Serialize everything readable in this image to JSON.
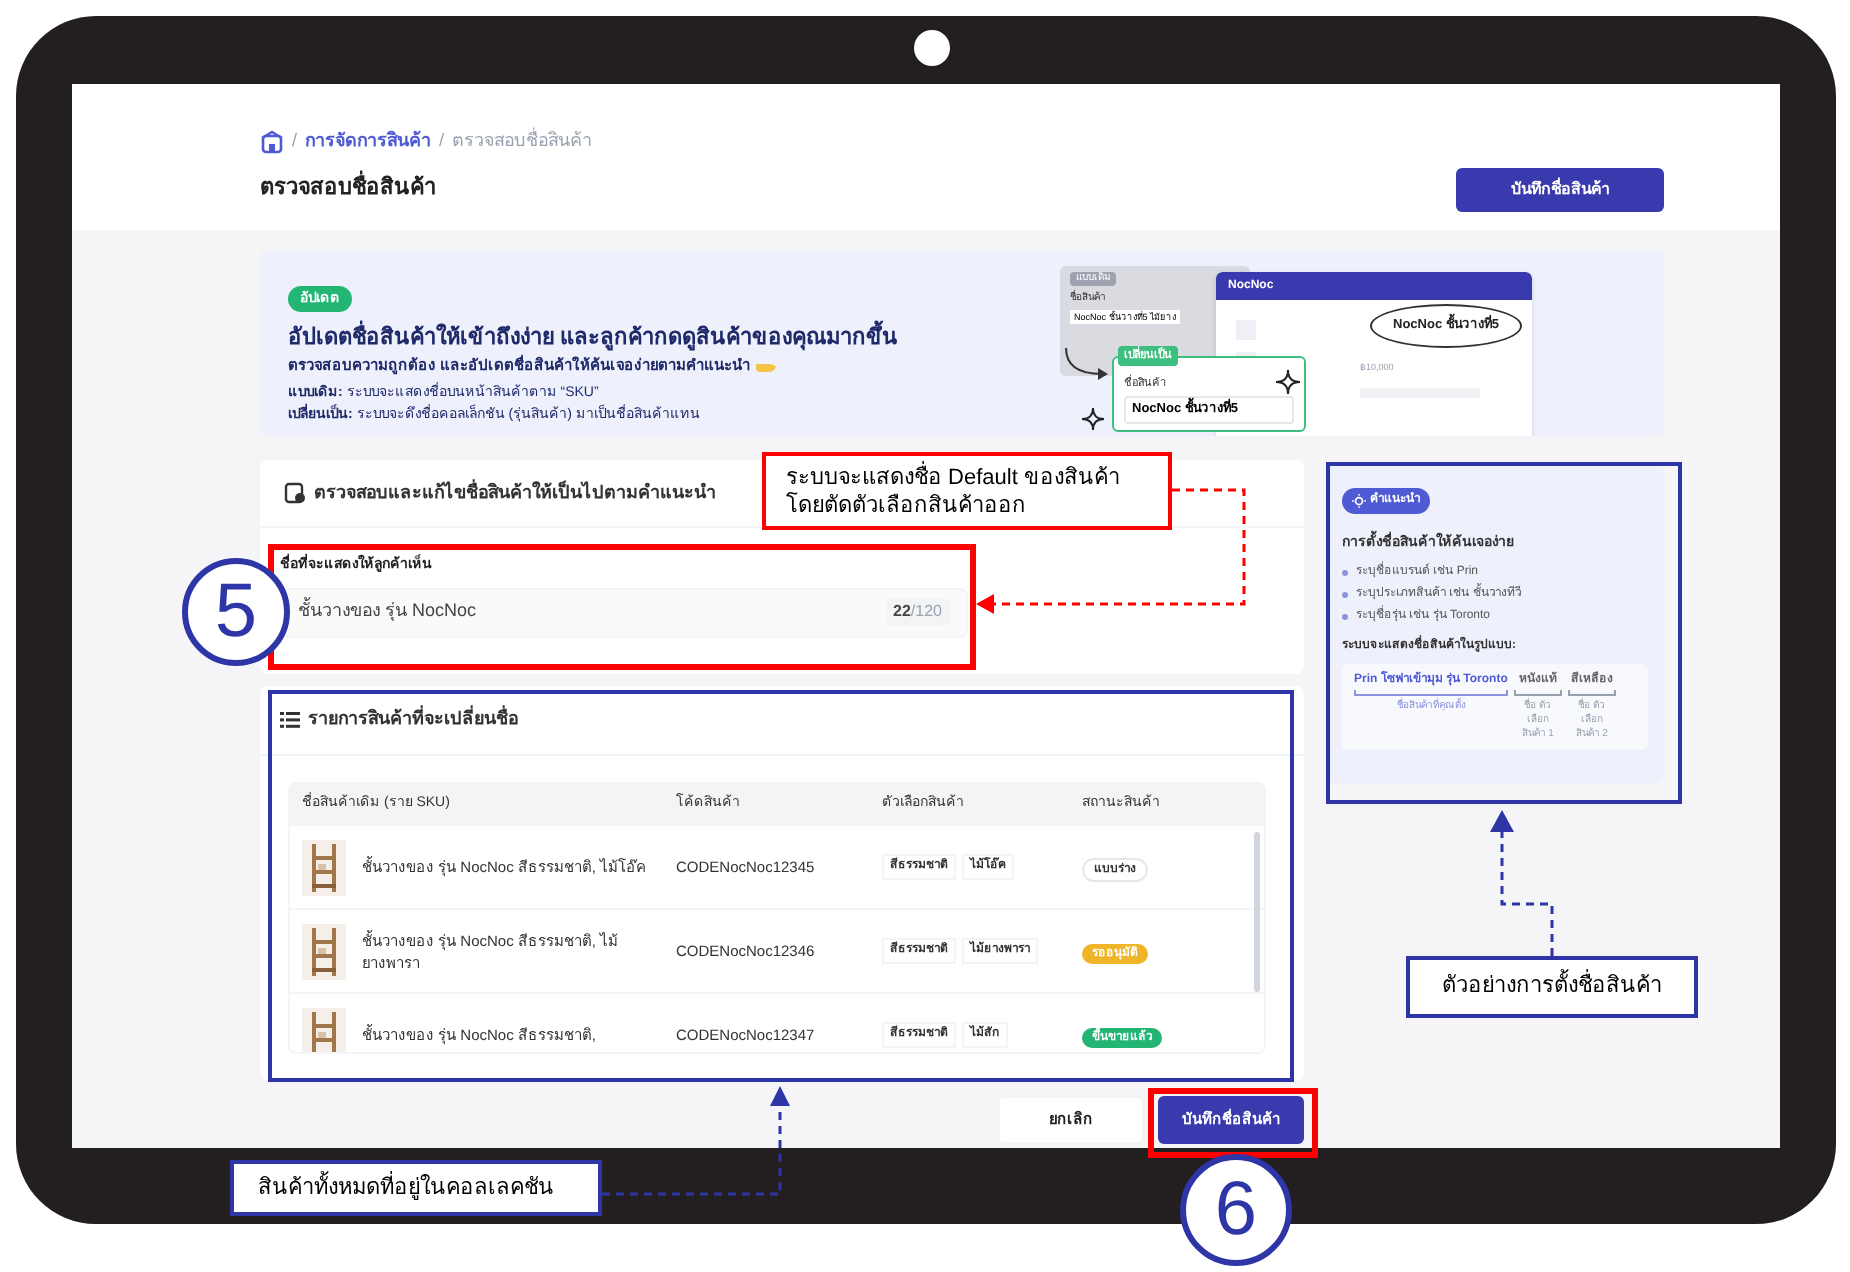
{
  "breadcrumb": {
    "separator": "/",
    "items": [
      {
        "label": "การจัดการสินค้า",
        "current": false
      },
      {
        "label": "ตรวจสอบชื่อสินค้า",
        "current": true
      }
    ]
  },
  "page_title": "ตรวจสอบชื่อสินค้า",
  "header_button": "บันทึกชื่อสินค้า",
  "banner": {
    "badge": "อัปเดต",
    "title": "อัปเดตชื่อสินค้าให้เข้าถึงง่าย และลูกค้ากดดูสินค้าของคุณมากขึ้น",
    "subtitle": "ตรวจสอบความถูกต้อง และอัปเดตชื่อสินค้าให้ค้นเจอง่ายตามคำแนะนำ",
    "lines": [
      "**แบบเดิม:** ระบบจะแสดงชื่อบนหน้าสินค้าตาม “SKU”",
      "**เปลี่ยนเป็น:** ระบบจะดึงชื่อคอลเล็กชัน (รุ่นสินค้า) มาเป็นชื่อสินค้าแทน"
    ],
    "illustration": {
      "old_badge": "แบบเดิม",
      "old_label": "ชื่อสินค้า",
      "old_value": "NocNoc ชั้นวางที่5 ไม้ยาง",
      "new_badge": "เปลี่ยนเป็น",
      "new_label": "ชื่อสินค้า",
      "new_value": "NocNoc ชั้นวางที่5",
      "preview_brand": "NocNoc",
      "preview_name": "NocNoc ชั้นวางที่5",
      "preview_price": "฿10,000"
    }
  },
  "name_section": {
    "title": "ตรวจสอบและแก้ไขชื่อสินค้าให้เป็นไปตามคำแนะนำ",
    "field_label": "ชื่อที่จะแสดงให้ลูกค้าเห็น",
    "field_value": "ชั้นวางของ รุ่น NocNoc",
    "count": "22",
    "max": "/120"
  },
  "list_section": {
    "title": "รายการสินค้าที่จะเปลี่ยนชื่อ",
    "columns": [
      "ชื่อสินค้าเดิม (ราย SKU)",
      "โค้ดสินค้า",
      "ตัวเลือกสินค้า",
      "สถานะสินค้า"
    ],
    "rows": [
      {
        "name": "ชั้นวางของ รุ่น NocNoc สีธรรมชาติ, ไม้โอ๊ค",
        "code": "CODENocNoc12345",
        "options": [
          "สีธรรมชาติ",
          "ไม้โอ๊ค"
        ],
        "status": {
          "label": "แบบร่าง",
          "kind": "draft"
        }
      },
      {
        "name": "ชั้นวางของ รุ่น NocNoc สีธรรมชาติ, ไม้ยางพารา",
        "code": "CODENocNoc12346",
        "options": [
          "สีธรรมชาติ",
          "ไม้ยางพารา"
        ],
        "status": {
          "label": "รออนุมัติ",
          "kind": "pending"
        }
      },
      {
        "name": "ชั้นวางของ รุ่น NocNoc สีธรรมชาติ,",
        "code": "CODENocNoc12347",
        "options": [
          "สีธรรมชาติ",
          "ไม้สัก"
        ],
        "status": {
          "label": "ขึ้นขายแล้ว",
          "kind": "live"
        }
      }
    ]
  },
  "tips": {
    "badge": "คำแนะนำ",
    "title": "การตั้งชื่อสินค้าให้ค้นเจอง่าย",
    "bullets": [
      "ระบุชื่อแบรนด์ เช่น Prin",
      "ระบุประเภทสินค้า เช่น ชั้นวางทีวี",
      "ระบุชื่อรุ่น เช่น รุ่น Toronto"
    ],
    "format_label": "ระบบจะแสดงชื่อสินค้าในรูปแบบ:",
    "example": [
      {
        "text": "Prin โซฟาเข้ามุม รุ่น Toronto",
        "caption": "ชื่อสินค้าที่คุณตั้ง",
        "kind": "name"
      },
      {
        "text": "หนังแท้",
        "caption": "ชื่อ ตัวเลือก สินค้า 1",
        "kind": "option"
      },
      {
        "text": "สีเหลือง",
        "caption": "ชื่อ ตัวเลือก สินค้า 2",
        "kind": "option"
      }
    ]
  },
  "footer_buttons": [
    {
      "label": "ยกเลิก",
      "kind": "secondary"
    },
    {
      "label": "บันทึกชื่อสินค้า",
      "kind": "primary"
    }
  ],
  "annotations": {
    "name_callout": "ระบบจะแสดงชื่อ Default ของสินค้า\nโดยตัดตัวเลือกสินค้าออก",
    "collection_callout": "สินค้าทั้งหมดที่อยู่ในคอลเลคชัน",
    "example_callout": "ตัวอย่างการตั้งชื่อสินค้า",
    "step_5": "5",
    "step_6": "6"
  }
}
